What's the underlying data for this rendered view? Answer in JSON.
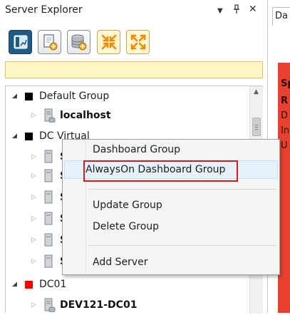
{
  "panel": {
    "title": "Server Explorer",
    "buttons": {
      "dropdown": "▼",
      "pin": "📌",
      "close": "✕"
    }
  },
  "toolbar": {
    "buttons": [
      {
        "name": "dashboard-button",
        "icon": "dashboard-icon"
      },
      {
        "name": "add-document-button",
        "icon": "add-document-icon"
      },
      {
        "name": "add-database-button",
        "icon": "add-database-icon"
      },
      {
        "name": "collapse-all-button",
        "icon": "collapse-arrows-icon"
      },
      {
        "name": "expand-all-button",
        "icon": "expand-arrows-icon"
      }
    ]
  },
  "filter": {
    "value": "",
    "placeholder": ""
  },
  "tree": {
    "groups": [
      {
        "label": "Default Group",
        "color": "#000000",
        "expanded": true,
        "servers": [
          {
            "label": "localhost"
          }
        ]
      },
      {
        "label": "DC Virtual",
        "color": "#000000",
        "expanded": true,
        "servers": [
          {
            "label": "S"
          },
          {
            "label": "S"
          },
          {
            "label": "S"
          },
          {
            "label": "S"
          },
          {
            "label": "S"
          },
          {
            "label": "S"
          }
        ]
      },
      {
        "label": "DC01",
        "color": "#ff0000",
        "expanded": true,
        "servers": [
          {
            "label": "DEV121-DC01"
          }
        ]
      }
    ]
  },
  "context_menu": {
    "items": [
      {
        "label": "Dashboard Group"
      },
      {
        "label": "AlwaysOn Dashboard Group",
        "highlighted": true
      },
      {
        "label": "Update Group"
      },
      {
        "label": "Delete Group"
      },
      {
        "label": "Add Server"
      }
    ]
  },
  "right_pane": {
    "tab_label": "Da",
    "lines": [
      {
        "text": "Sp",
        "bold": true
      },
      {
        "text": "R",
        "bold": true
      },
      {
        "text": "D",
        "bold": false
      },
      {
        "text": "In",
        "bold": false
      },
      {
        "text": "U",
        "bold": false
      }
    ]
  },
  "colors": {
    "accent_highlight": "#d41c1c",
    "filter_bg": "#fff6c8",
    "alert_red": "#e8412f"
  }
}
